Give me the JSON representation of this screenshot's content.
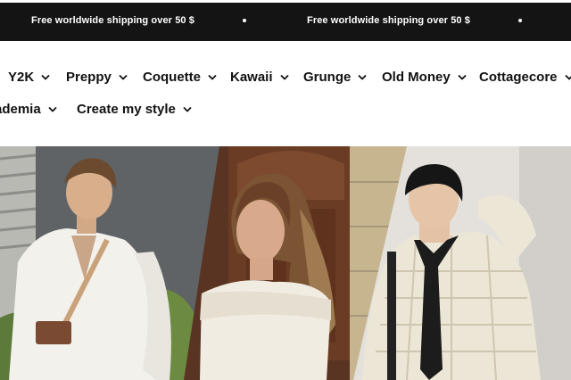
{
  "announcement": {
    "messages": [
      "Free worldwide shipping over 50 $",
      "Free worldwide shipping over 50 $"
    ]
  },
  "nav": {
    "row1": [
      {
        "label": "Y2K"
      },
      {
        "label": "Preppy"
      },
      {
        "label": "Coquette"
      },
      {
        "label": "Kawaii"
      },
      {
        "label": "Grunge"
      },
      {
        "label": "Old Money"
      },
      {
        "label": "Cottagecore"
      }
    ],
    "row2": [
      {
        "label": "ademia"
      },
      {
        "label": "Create my style"
      }
    ]
  },
  "hero": {
    "panels": [
      "preppy-outfit-photo",
      "old-money-outfit-photo",
      "grunge-outfit-photo"
    ]
  },
  "colors": {
    "announcement_bg": "#141414",
    "announcement_text": "#ffffff",
    "nav_text": "#111111"
  }
}
